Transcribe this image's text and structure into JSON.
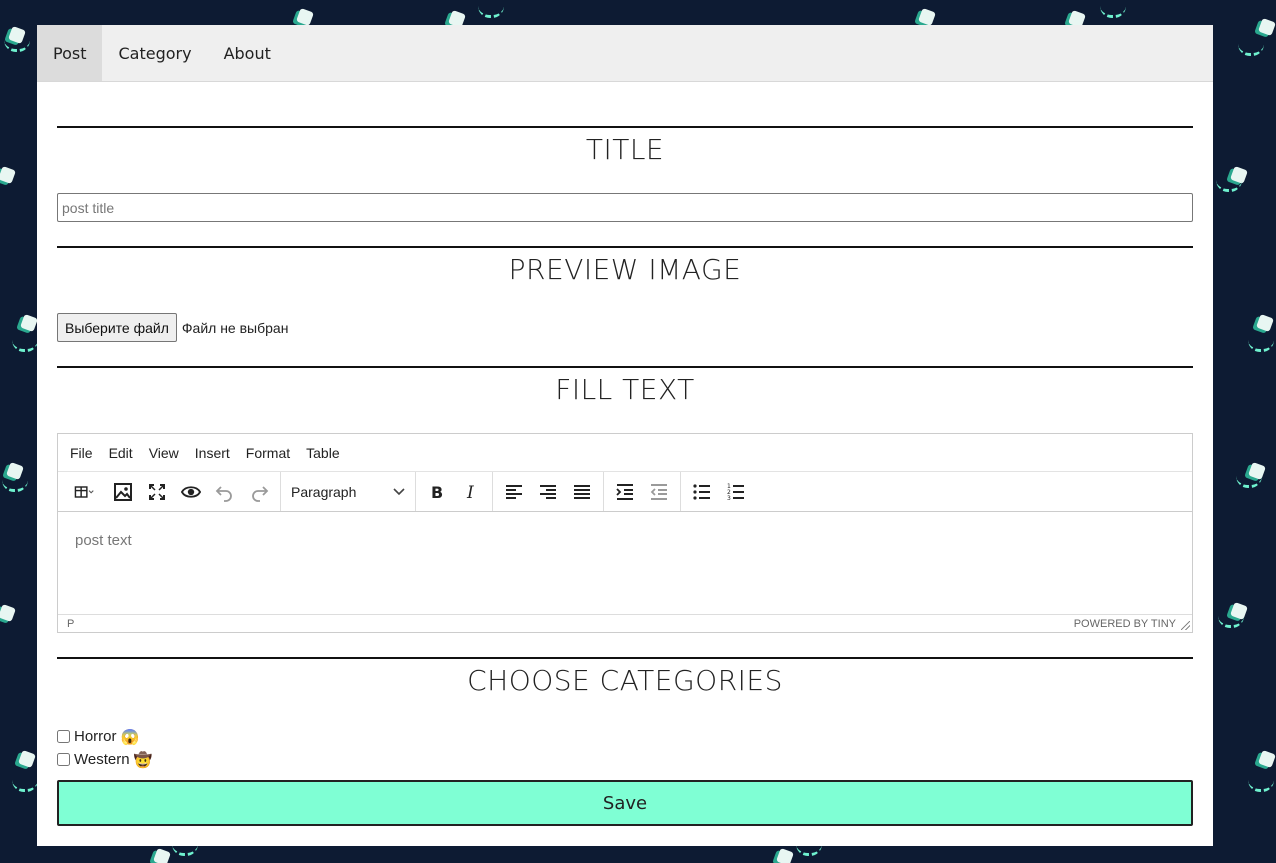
{
  "nav": {
    "items": [
      {
        "label": "Post",
        "active": true
      },
      {
        "label": "Category",
        "active": false
      },
      {
        "label": "About",
        "active": false
      }
    ]
  },
  "sections": {
    "title_heading": "TITLE",
    "preview_heading": "PREVIEW IMAGE",
    "text_heading": "FILL TEXT",
    "categories_heading": "CHOOSE CATEGORIES"
  },
  "title_input": {
    "placeholder": "post title",
    "value": ""
  },
  "file_picker": {
    "button_label": "Выберите файл",
    "status": "Файл не выбран"
  },
  "editor": {
    "menu": [
      "File",
      "Edit",
      "View",
      "Insert",
      "Format",
      "Table"
    ],
    "block_format": "Paragraph",
    "placeholder": "post text",
    "path": "P",
    "branding": "POWERED BY TINY",
    "toolbar_icons": [
      "table-icon",
      "image-icon",
      "fullscreen-icon",
      "preview-icon",
      "undo-icon",
      "redo-icon",
      "bold-icon",
      "italic-icon",
      "align-left-icon",
      "align-right-icon",
      "align-justify-icon",
      "indent-icon",
      "outdent-icon",
      "bullet-list-icon",
      "numbered-list-icon"
    ]
  },
  "categories": [
    {
      "label": "Horror",
      "emoji": "😱",
      "checked": false
    },
    {
      "label": "Western",
      "emoji": "🤠",
      "checked": false
    }
  ],
  "save_label": "Save",
  "colors": {
    "background": "#0d1b33",
    "accent": "#7fffd4",
    "nav": "#efefef"
  }
}
